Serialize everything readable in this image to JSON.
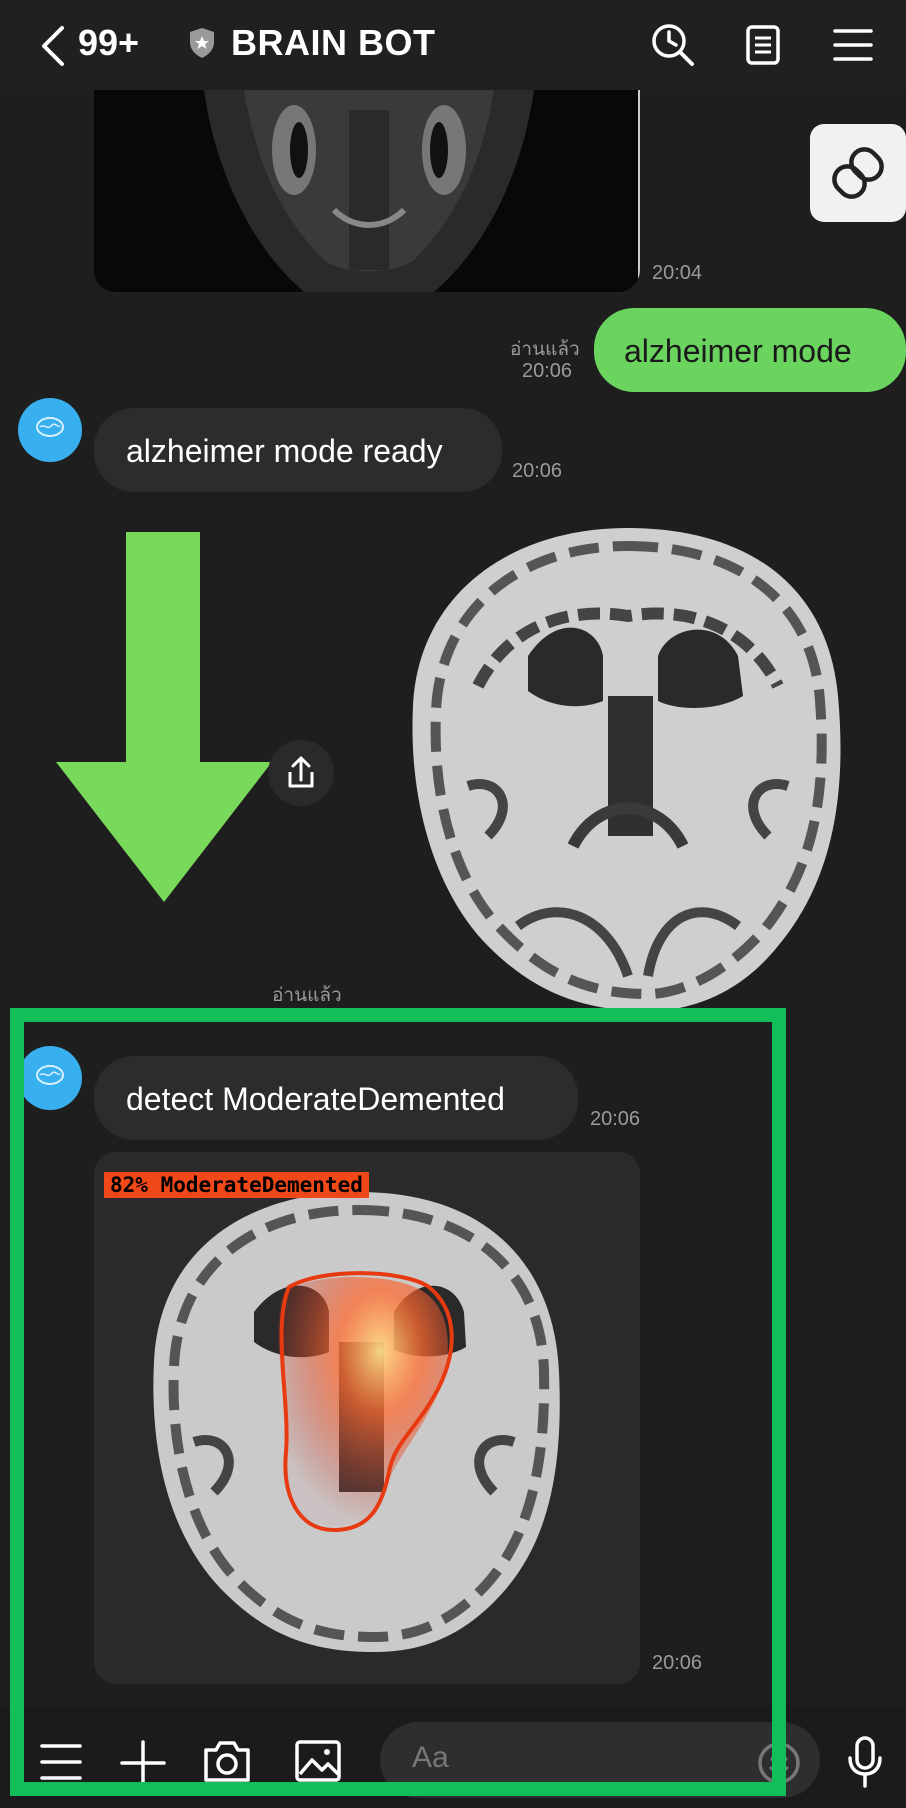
{
  "header": {
    "unread_count": "99+",
    "title": "BRAIN BOT"
  },
  "messages": {
    "img1_time": "20:04",
    "out1": {
      "text": "alzheimer mode",
      "read": "อ่านแล้ว",
      "time": "20:06"
    },
    "in1": {
      "text": "alzheimer mode ready",
      "time": "20:06"
    },
    "img2_read": "อ่านแล้ว",
    "in2": {
      "text": "detect ModerateDemented",
      "time": "20:06"
    },
    "result_label": "82% ModerateDemented",
    "img3_time": "20:06"
  },
  "input": {
    "placeholder": "Aa"
  },
  "colors": {
    "accent_green": "#6ad45f",
    "highlight_box": "#11bf5a",
    "arrow": "#79d95a",
    "detect_badge": "#f04818",
    "avatar": "#38b0f0"
  },
  "icons": [
    "chevron-left-icon",
    "shield-icon",
    "clock-search-icon",
    "notes-icon",
    "menu-icon",
    "link-icon",
    "share-icon",
    "menu-icon",
    "plus-icon",
    "camera-icon",
    "image-icon",
    "emoji-icon",
    "mic-icon"
  ]
}
